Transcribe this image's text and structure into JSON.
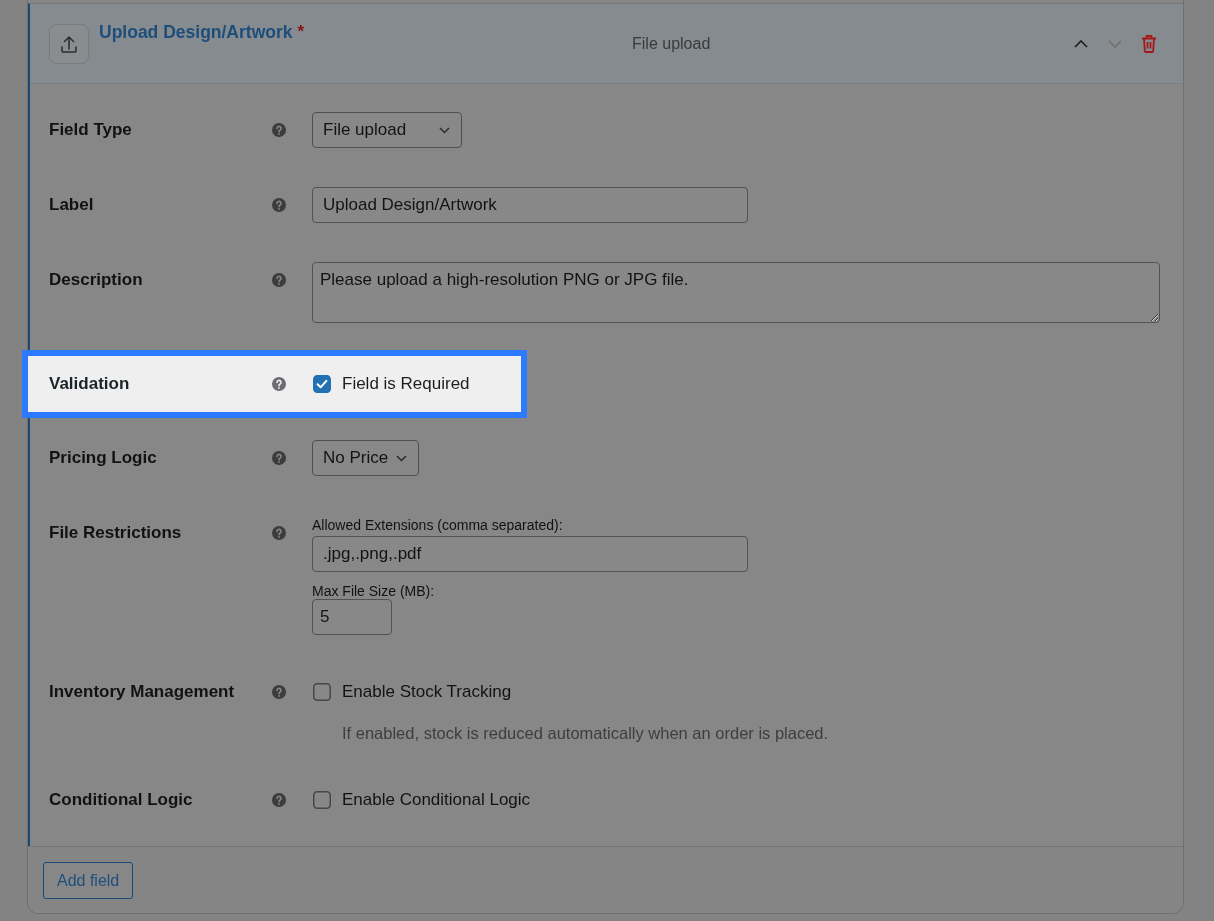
{
  "field": {
    "title": "Upload Design/Artwork",
    "required_mark": "*",
    "type_label": "File upload",
    "actions": [
      {
        "kind": "move_up",
        "disabled": false
      },
      {
        "kind": "move_down",
        "disabled": true
      },
      {
        "kind": "delete",
        "disabled": false
      }
    ]
  },
  "rows": [
    {
      "kind": "select",
      "label": "Field Type",
      "value": "File upload",
      "highlighted": false
    },
    {
      "kind": "text",
      "label": "Label",
      "value": "Upload Design/Artwork",
      "highlighted": false
    },
    {
      "kind": "textarea",
      "label": "Description",
      "value": "Please upload a high-resolution PNG or JPG file.",
      "highlighted": false
    },
    {
      "kind": "checkbox",
      "label": "Validation",
      "option": "Field is Required",
      "checked": true,
      "highlighted": true
    },
    {
      "kind": "select",
      "label": "Pricing Logic",
      "value": "No Price",
      "highlighted": false
    },
    {
      "kind": "file_restrictions",
      "label": "File Restrictions",
      "extensions_label": "Allowed Extensions (comma separated):",
      "extensions": ".jpg,.png,.pdf",
      "max_size_label": "Max File Size (MB):",
      "max_size": "5",
      "highlighted": false
    },
    {
      "kind": "checkbox",
      "label": "Inventory Management",
      "option": "Enable Stock Tracking",
      "checked": false,
      "hint": "If enabled, stock is reduced automatically when an order is placed.",
      "highlighted": false
    },
    {
      "kind": "checkbox",
      "label": "Conditional Logic",
      "option": "Enable Conditional Logic",
      "checked": false,
      "highlighted": false
    }
  ],
  "footer": {
    "add_button": "Add field"
  }
}
